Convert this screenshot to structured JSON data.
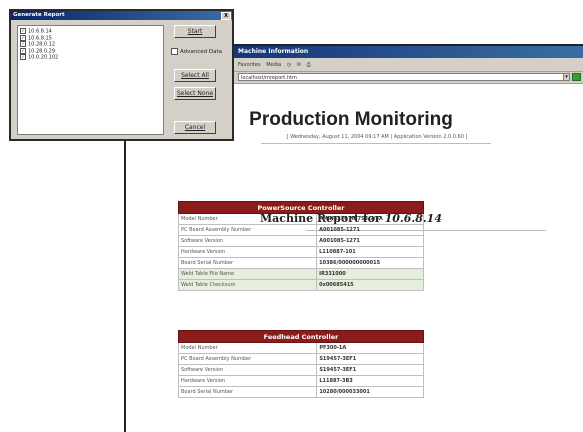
{
  "browser": {
    "title": "Machine Information",
    "toolbar": [
      "Favorites",
      "Media"
    ],
    "address": "localhost/mreport.htm",
    "heading": "Production Monitoring",
    "subtitle": "[ Wednesday, August 11, 2004 09:17 AM | Application Version 2.0.0.60 ]",
    "machine_report_prefix": "Machine Report for",
    "machine_ip": "10.6.8.14"
  },
  "power_source": {
    "header": "PowerSource Controller",
    "rows": [
      {
        "label": "Model Number",
        "value": "PMIN3270 HI-753-7/SA",
        "shade": false
      },
      {
        "label": "PC Board Assembly Number",
        "value": "A001085-1271",
        "shade": false
      },
      {
        "label": "Software Version",
        "value": "A001085-1271",
        "shade": false
      },
      {
        "label": "Hardware Version",
        "value": "L110887-101",
        "shade": false
      },
      {
        "label": "Board Serial Number",
        "value": "10386/000000000015",
        "shade": false
      },
      {
        "label": "Weld Table File Name",
        "value": "IR331000",
        "shade": true
      },
      {
        "label": "Weld Table Checksum",
        "value": "0x00685415",
        "shade": true
      }
    ]
  },
  "feedhead": {
    "header": "Feedhead Controller",
    "rows": [
      {
        "label": "Model Number",
        "value": "PF300-1A",
        "shade": false
      },
      {
        "label": "PC Board Assembly Number",
        "value": "S19457-3EF1",
        "shade": false
      },
      {
        "label": "Software Version",
        "value": "S19457-3EF1",
        "shade": false
      },
      {
        "label": "Hardware Version",
        "value": "L11887-3B3",
        "shade": false
      },
      {
        "label": "Board Serial Number",
        "value": "10280/000033001",
        "shade": false
      }
    ]
  },
  "dialog": {
    "title": "Generate Report",
    "close": "X",
    "ips": [
      "10.6.8.14",
      "10.6.8.15",
      "10.28.0.12",
      "10.28.0.29",
      "10.0.20.102"
    ],
    "start_label": "Start",
    "advanced_label": "Advanced Data",
    "select_all_label": "Select All",
    "select_none_label": "Select None",
    "cancel_label": "Cancel"
  },
  "colors": {
    "table_header": "#8b1c1c",
    "title_bar": "#0a246a",
    "shade_row": "#e6eedd"
  }
}
